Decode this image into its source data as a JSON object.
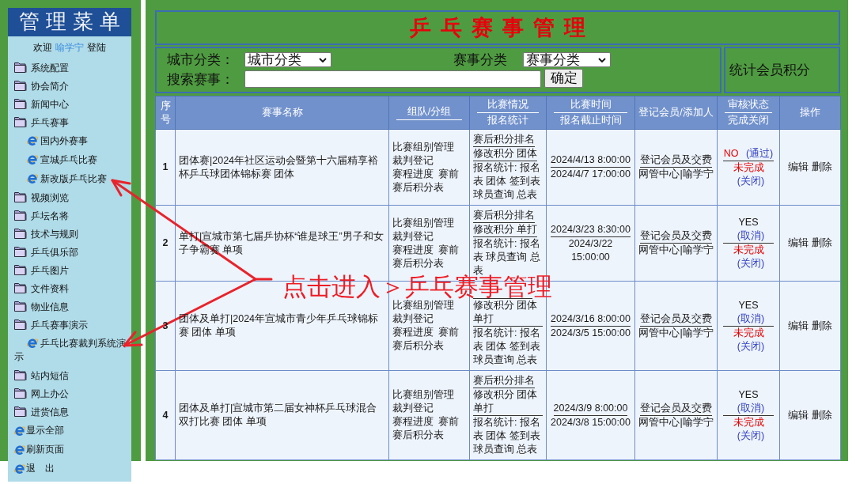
{
  "sidebar": {
    "title": "管理菜单",
    "welcome": {
      "prefix": "欢迎",
      "user": "喻学宁",
      "suffix": "登陆"
    },
    "items": [
      {
        "kind": "folder",
        "label": "系统配置"
      },
      {
        "kind": "folder",
        "label": "协会简介"
      },
      {
        "kind": "folder",
        "label": "新闻中心"
      },
      {
        "kind": "folder",
        "label": "乒乓赛事",
        "children": [
          {
            "kind": "page",
            "label": "国内外赛事"
          },
          {
            "kind": "page",
            "label": "宣城乒乓比赛"
          },
          {
            "kind": "page",
            "label": "新改版乒乓比赛"
          }
        ]
      },
      {
        "kind": "folder",
        "label": "视频浏览"
      },
      {
        "kind": "folder",
        "label": "乒坛名将"
      },
      {
        "kind": "folder",
        "label": "技术与规则"
      },
      {
        "kind": "folder",
        "label": "乒乓俱乐部"
      },
      {
        "kind": "folder",
        "label": "乒乓图片"
      },
      {
        "kind": "folder",
        "label": "文件资料"
      },
      {
        "kind": "folder",
        "label": "物业信息"
      },
      {
        "kind": "folder",
        "label": "乒乓赛事演示",
        "children": [
          {
            "kind": "page",
            "label": "乒乓比赛裁判系统演示"
          }
        ]
      },
      {
        "kind": "folder",
        "label": "站内短信"
      },
      {
        "kind": "folder",
        "label": "网上办公"
      },
      {
        "kind": "folder",
        "label": "进货信息"
      },
      {
        "kind": "action",
        "label": "显示全部"
      },
      {
        "kind": "action",
        "label": "刷新页面"
      },
      {
        "kind": "action",
        "label": "退　出"
      }
    ]
  },
  "header": {
    "title": "乒乓赛事管理"
  },
  "filters": {
    "city_label": "城市分类：",
    "city_value": "城市分类",
    "category_label": "赛事分类",
    "category_value": "赛事分类",
    "search_label": "搜索赛事：",
    "submit": "确定",
    "stats_link": "统计会员积分"
  },
  "table": {
    "columns": [
      {
        "kind": "plain",
        "label": "序号"
      },
      {
        "kind": "plain",
        "label": "赛事名称"
      },
      {
        "kind": "split",
        "label": "组队/分组"
      },
      {
        "kind": "split",
        "label": "比赛情况",
        "sublabel": "报名统计"
      },
      {
        "kind": "split",
        "label": "比赛时间",
        "sublabel": "报名截止时间"
      },
      {
        "kind": "plain",
        "label": "登记会员/添加人"
      },
      {
        "kind": "split",
        "label": "审核状态",
        "sublabel": "完成关闭"
      },
      {
        "kind": "plain",
        "label": "操作"
      }
    ],
    "rows": [
      {
        "no": "1",
        "name": "团体赛|2024年社区运动会暨第十六届精享裕杯乒乓球团体锦标赛 团体",
        "group_links": [
          "比赛组别管理",
          "裁判登记",
          "赛程进度",
          "赛前",
          "赛后积分表"
        ],
        "rank_link": "赛后积分排名",
        "edit_links": [
          "修改积分",
          "团体"
        ],
        "signup": "报名统计: 报名表 团体 签到表球员查询 总表",
        "match_time": "2024/4/13 8:00:00",
        "deadline": "2024/4/7 17:00:00",
        "member_link": "登记会员及交费",
        "added_by": "网管中心|喻学宁",
        "audit": {
          "label": "NO",
          "approved": false,
          "action": "(通过)"
        },
        "completion": {
          "label": "未完成",
          "completed": false,
          "action": "(关闭)"
        },
        "actions": [
          "编辑",
          "删除"
        ]
      },
      {
        "no": "2",
        "name": "单打|宣城市第七届乒协杯“谁是球王”男子和女子争霸赛 单项",
        "group_links": [
          "比赛组别管理",
          "裁判登记",
          "赛程进度",
          "赛前",
          "赛后积分表"
        ],
        "rank_link": "赛后积分排名",
        "edit_links": [
          "修改积分",
          "单打"
        ],
        "signup": "报名统计: 报名表 球员查询 总表",
        "match_time": "2024/3/23 8:30:00",
        "deadline": "2024/3/22 15:00:00",
        "member_link": "登记会员及交费",
        "added_by": "网管中心|喻学宁",
        "audit": {
          "label": "YES",
          "approved": true,
          "action": "(取消)"
        },
        "completion": {
          "label": "未完成",
          "completed": false,
          "action": "(关闭)"
        },
        "actions": [
          "编辑",
          "删除"
        ]
      },
      {
        "no": "3",
        "name": "团体及单打|2024年宣城市青少年乒乓球锦标赛 团体 单项",
        "group_links": [
          "比赛组别管理",
          "裁判登记",
          "赛程进度",
          "赛前",
          "赛后积分表"
        ],
        "edit_links": [
          "修改积分",
          "团体",
          "单打"
        ],
        "signup": "报名统计: 报名表 团体 签到表球员查询 总表",
        "match_time": "2024/3/16 8:00:00",
        "deadline": "2024/3/5 15:00:00",
        "member_link": "登记会员及交费",
        "added_by": "网管中心|喻学宁",
        "audit": {
          "label": "YES",
          "approved": true,
          "action": "(取消)"
        },
        "completion": {
          "label": "未完成",
          "completed": false,
          "action": "(关闭)"
        },
        "actions": [
          "编辑",
          "删除"
        ]
      },
      {
        "no": "4",
        "name": "团体及单打|宣城市第二届女神杯乒乓球混合双打比赛 团体 单项",
        "group_links": [
          "比赛组别管理",
          "裁判登记",
          "赛程进度",
          "赛前",
          "赛后积分表"
        ],
        "rank_link": "赛后积分排名",
        "edit_links": [
          "修改积分",
          "团体",
          "单打"
        ],
        "signup": "报名统计: 报名表 团体 签到表球员查询 总表",
        "match_time": "2024/3/9 8:00:00",
        "deadline": "2024/3/8 15:00:00",
        "member_link": "登记会员及交费",
        "added_by": "网管中心|喻学宁",
        "audit": {
          "label": "YES",
          "approved": true,
          "action": "(取消)"
        },
        "completion": {
          "label": "未完成",
          "completed": false,
          "action": "(关闭)"
        },
        "actions": [
          "编辑",
          "删除"
        ]
      }
    ]
  },
  "annotation": {
    "text": "点击进入＞乒乓赛事管理"
  }
}
